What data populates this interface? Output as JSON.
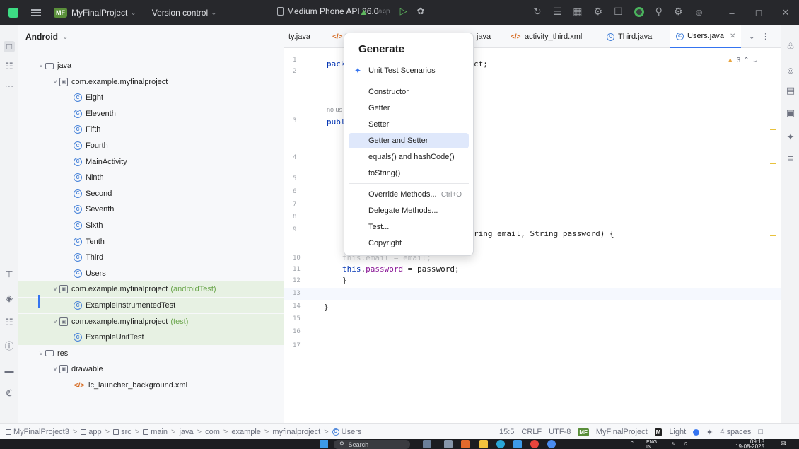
{
  "titlebar": {
    "badge": "MF",
    "project": "MyFinalProject",
    "version_control": "Version control",
    "device": "Medium Phone API 36.0",
    "run_config": "app"
  },
  "project_panel": {
    "title": "Android",
    "tree": [
      {
        "label": "java",
        "icon": "folder",
        "indent": 1,
        "arrow": "v"
      },
      {
        "label": "com.example.myfinalproject",
        "icon": "package",
        "indent": 2,
        "arrow": "v"
      },
      {
        "label": "Eight",
        "icon": "class",
        "indent": 3
      },
      {
        "label": "Eleventh",
        "icon": "class",
        "indent": 3
      },
      {
        "label": "Fifth",
        "icon": "class",
        "indent": 3
      },
      {
        "label": "Fourth",
        "icon": "class",
        "indent": 3
      },
      {
        "label": "MainActivity",
        "icon": "class",
        "indent": 3
      },
      {
        "label": "Ninth",
        "icon": "class",
        "indent": 3
      },
      {
        "label": "Second",
        "icon": "class",
        "indent": 3
      },
      {
        "label": "Seventh",
        "icon": "class",
        "indent": 3
      },
      {
        "label": "Sixth",
        "icon": "class",
        "indent": 3
      },
      {
        "label": "Tenth",
        "icon": "class",
        "indent": 3
      },
      {
        "label": "Third",
        "icon": "class",
        "indent": 3
      },
      {
        "label": "Users",
        "icon": "class",
        "indent": 3,
        "selected": true
      },
      {
        "label": "com.example.myfinalproject",
        "sub": "(androidTest)",
        "icon": "package",
        "indent": 2,
        "arrow": "v",
        "test": true
      },
      {
        "label": "ExampleInstrumentedTest",
        "icon": "class",
        "indent": 3,
        "test": true
      },
      {
        "label": "com.example.myfinalproject",
        "sub": "(test)",
        "icon": "package",
        "indent": 2,
        "arrow": "v",
        "test": true
      },
      {
        "label": "ExampleUnitTest",
        "icon": "class",
        "indent": 3,
        "test": true
      },
      {
        "label": "res",
        "icon": "res",
        "indent": 1,
        "arrow": "v"
      },
      {
        "label": "drawable",
        "icon": "package",
        "indent": 2,
        "arrow": "v"
      },
      {
        "label": "ic_launcher_background.xml",
        "icon": "xml",
        "indent": 3
      }
    ]
  },
  "tabs": [
    {
      "label": "ty.java",
      "icon": "none"
    },
    {
      "label": "",
      "icon": "xml"
    },
    {
      "label": "java",
      "icon": "none"
    },
    {
      "label": "activity_third.xml",
      "icon": "xml"
    },
    {
      "label": "Third.java",
      "icon": "class"
    },
    {
      "label": "Users.java",
      "icon": "class",
      "active": true
    }
  ],
  "editor": {
    "warnings": "3",
    "lines": [
      "1",
      "2",
      "3",
      "4",
      "5",
      "6",
      "7",
      "8",
      "9",
      "10",
      "11",
      "12",
      "13",
      "14",
      "15",
      "16",
      "17"
    ],
    "code": {
      "l1": "pack",
      "l1b": "ct;",
      "hint": "no us",
      "l3": "publ",
      "l10": "ring email, String password) {",
      "l12": "this.email = email;",
      "l13_kw": "this",
      "l13_fld": "password",
      "l13_rest": " = password;",
      "l14": "}",
      "l16": "}"
    }
  },
  "popup": {
    "title": "Generate",
    "items": [
      {
        "label": "Unit Test Scenarios",
        "spark": true
      },
      {
        "label": "Constructor"
      },
      {
        "label": "Getter"
      },
      {
        "label": "Setter"
      },
      {
        "label": "Getter and Setter",
        "highlighted": true
      },
      {
        "label": "equals() and hashCode()"
      },
      {
        "label": "toString()"
      },
      {
        "label": "Override Methods...",
        "shortcut": "Ctrl+O"
      },
      {
        "label": "Delegate Methods..."
      },
      {
        "label": "Test..."
      },
      {
        "label": "Copyright"
      }
    ]
  },
  "statusbar": {
    "breadcrumb": [
      "MyFinalProject3",
      "app",
      "src",
      "main",
      "java",
      "com",
      "example",
      "myfinalproject",
      "Users"
    ],
    "position": "15:5",
    "line_ending": "CRLF",
    "encoding": "UTF-8",
    "badge": "MF",
    "project": "MyFinalProject",
    "theme_badge": "M",
    "theme": "Light",
    "indent": "4 spaces"
  },
  "taskbar": {
    "search": "Search",
    "lang": "ENG",
    "region": "IN",
    "time": "09:18",
    "date": "19-08-2025"
  },
  "colors": {
    "accent": "#3574f0",
    "test_bg": "#e7f1e3",
    "highlight": "#dfe8fb"
  }
}
